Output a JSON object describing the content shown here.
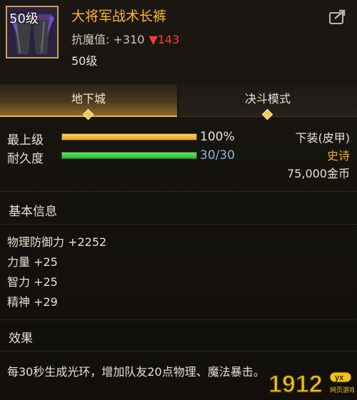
{
  "header": {
    "level_badge": "50级",
    "item_name": "大将军战术长裤",
    "resist_label": "抗魔值: +310",
    "resist_change": "▼143",
    "level_text": "50级",
    "share_icon": "share-icon"
  },
  "tabs": [
    {
      "label": "地下城",
      "active": true
    },
    {
      "label": "决斗模式",
      "active": false
    }
  ],
  "stats": {
    "max_level": {
      "label": "最上级",
      "value": "100%",
      "fill": 1.0,
      "color": "#f2a21f"
    },
    "durability": {
      "label": "耐久度",
      "value": "30/30",
      "fill": 1.0,
      "color": "#1fc22a"
    }
  },
  "item_info": {
    "type": "下装(皮甲)",
    "rarity": "史诗",
    "price": "75,000金币"
  },
  "basic": {
    "title": "基本信息",
    "attrs": [
      "物理防御力 +2252",
      "力量 +25",
      "智力 +25",
      "精神 +29"
    ]
  },
  "effect": {
    "title": "效果",
    "text": "每30秒生成光环，增加队友20点物理、魔法暴击。"
  },
  "watermark": {
    "main": "1912",
    "badge": "yx",
    "sub": "网页游戏"
  }
}
